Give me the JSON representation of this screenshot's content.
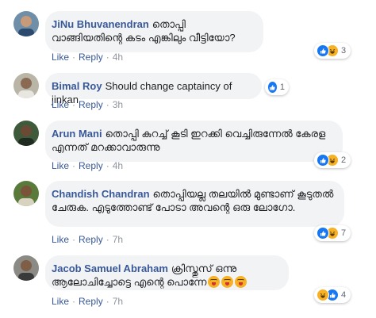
{
  "actions": {
    "like": "Like",
    "reply": "Reply",
    "separator": "·"
  },
  "colors": {
    "author_link": "#385898",
    "bubble_bg": "#f2f3f5",
    "like_blue": "#1877f2",
    "haha_yellow": "#f7b125"
  },
  "comments": [
    {
      "author": "JiNu Bhuvanendran",
      "text": "തൊപ്പി വാങ്ങിയതിന്റെ കടം എങ്കിലും വീട്ടിയോ?",
      "time": "4h",
      "reactions": [
        "like-icon",
        "haha-icon"
      ],
      "reaction_count": "3"
    },
    {
      "author": "Bimal Roy",
      "text": "Should change captaincy of jinkan",
      "time": "3h",
      "reactions": [
        "like-icon"
      ],
      "reaction_count": "1"
    },
    {
      "author": "Arun Mani",
      "text": "തൊപ്പി കുറച്ച് കൂടി ഇറക്കി വെച്ചിരുന്നേൽ കേരള എന്നത് മറക്കാവാരുന്നു",
      "time": "4h",
      "reactions": [
        "like-icon",
        "haha-icon"
      ],
      "reaction_count": "2"
    },
    {
      "author": "Chandish Chandran",
      "text": "തൊപ്പിയല്ല തലയിൽ മുണ്ടാണ് കൂടുതൽ ചേരുക. എടുത്തോണ്ട് പോടാ അവന്റെ ഒരു ലോഗോ.",
      "time": "7h",
      "reactions": [
        "like-icon",
        "haha-icon"
      ],
      "reaction_count": "7"
    },
    {
      "author": "Jacob Samuel Abraham",
      "text": "ക്രിസ്തുസ് ഒന്നു ആലോചിച്ചോട്ടെ എന്റെ പൊന്നേ",
      "time": "7h",
      "emojis": [
        "tongue-out-emoji",
        "tongue-out-emoji",
        "tongue-out-emoji"
      ],
      "reactions": [
        "haha-icon",
        "like-icon"
      ],
      "reaction_count": "4"
    }
  ]
}
